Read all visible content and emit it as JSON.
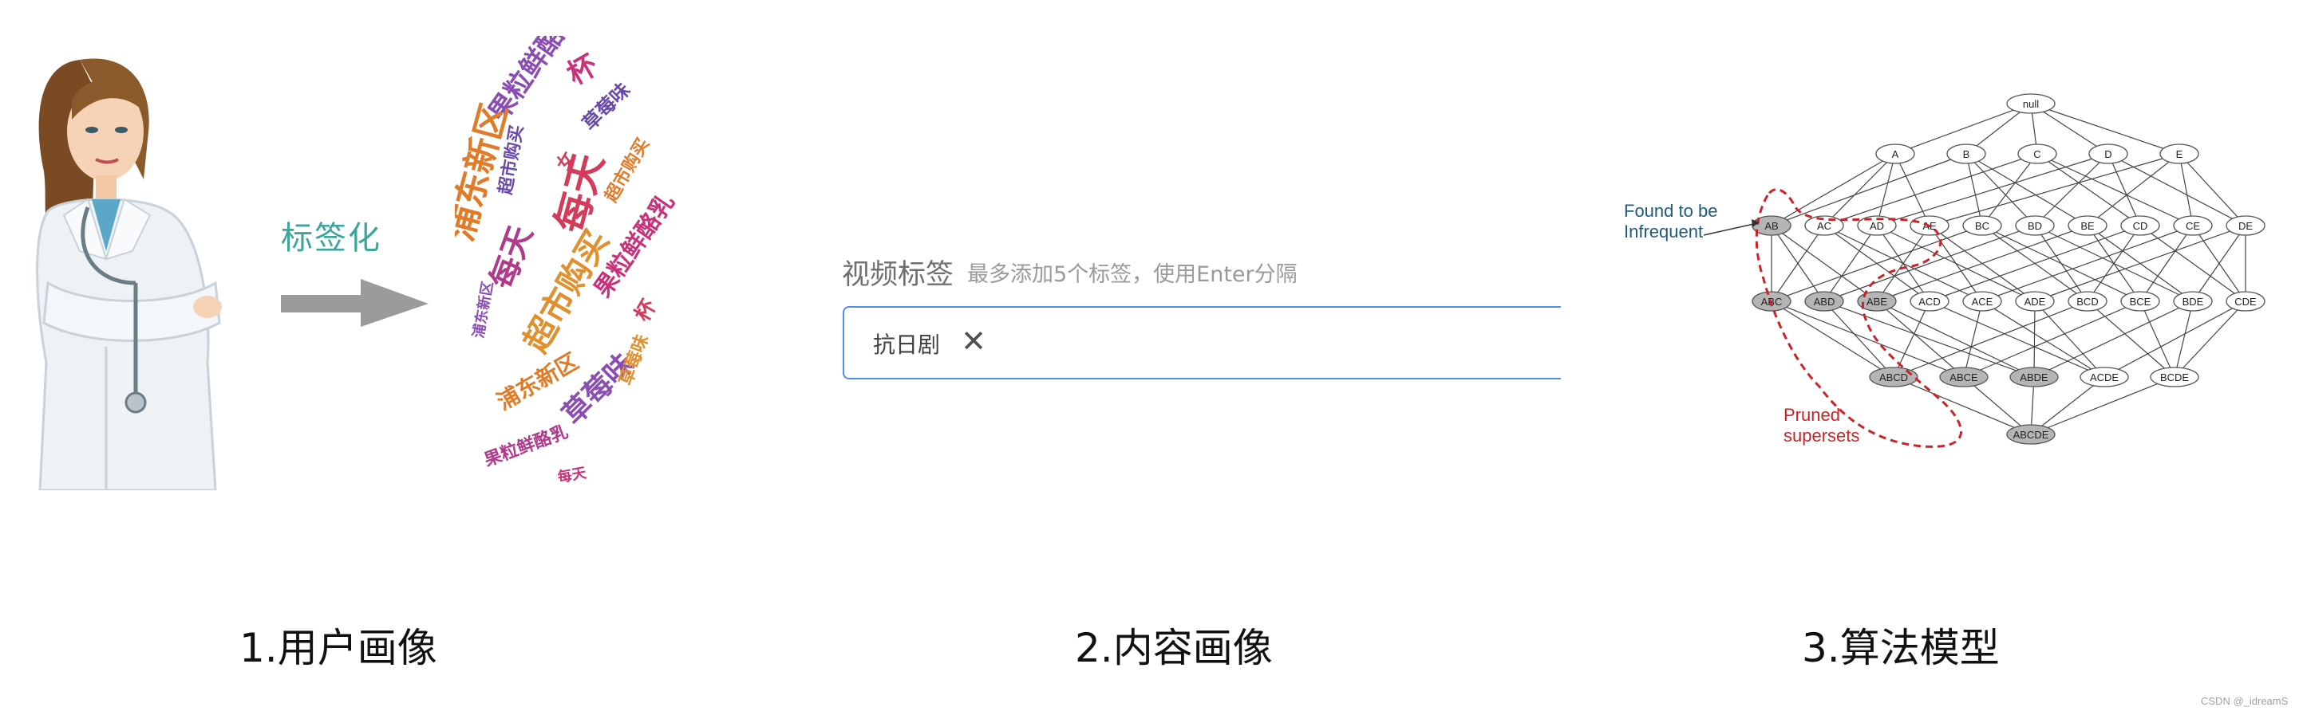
{
  "panel1": {
    "arrow_label": "标签化",
    "wordcloud_words": [
      "杯",
      "果粒鲜酪乳",
      "浦东新区",
      "女",
      "草莓味",
      "每天",
      "超市购买",
      "果粒鲜酪乳",
      "草莓味",
      "浦东新区",
      "每天",
      "超市购买",
      "果粒鲜酪乳",
      "草莓味",
      "每天",
      "浦东新区",
      "超市购买",
      "杯"
    ],
    "wordcloud_colors": [
      "#c8327a",
      "#8a4db3",
      "#e07b2a",
      "#d23b5a",
      "#6a4aa8",
      "#b03a8c",
      "#e0902f"
    ]
  },
  "panel2": {
    "field_title": "视频标签",
    "field_hint": "最多添加5个标签，使用Enter分隔",
    "tag": "抗日剧",
    "close_glyph": "✕"
  },
  "panel3": {
    "nodes": {
      "level0": [
        "null"
      ],
      "level1": [
        "A",
        "B",
        "C",
        "D",
        "E"
      ],
      "level2": [
        "AB",
        "AC",
        "AD",
        "AE",
        "BC",
        "BD",
        "BE",
        "CD",
        "CE",
        "DE"
      ],
      "level3": [
        "ABC",
        "ABD",
        "ABE",
        "ACD",
        "ACE",
        "ADE",
        "BCD",
        "BCE",
        "BDE",
        "CDE"
      ],
      "level4": [
        "ABCD",
        "ABCE",
        "ABDE",
        "ACDE",
        "BCDE"
      ],
      "level5": [
        "ABCDE"
      ]
    },
    "infrequent_label": [
      "Found to be",
      "Infrequent"
    ],
    "pruned_label": [
      "Pruned",
      "supersets"
    ]
  },
  "captions": {
    "c1": "1.用户画像",
    "c2": "2.内容画像",
    "c3": "3.算法模型"
  },
  "watermark": "CSDN @_idreamS"
}
